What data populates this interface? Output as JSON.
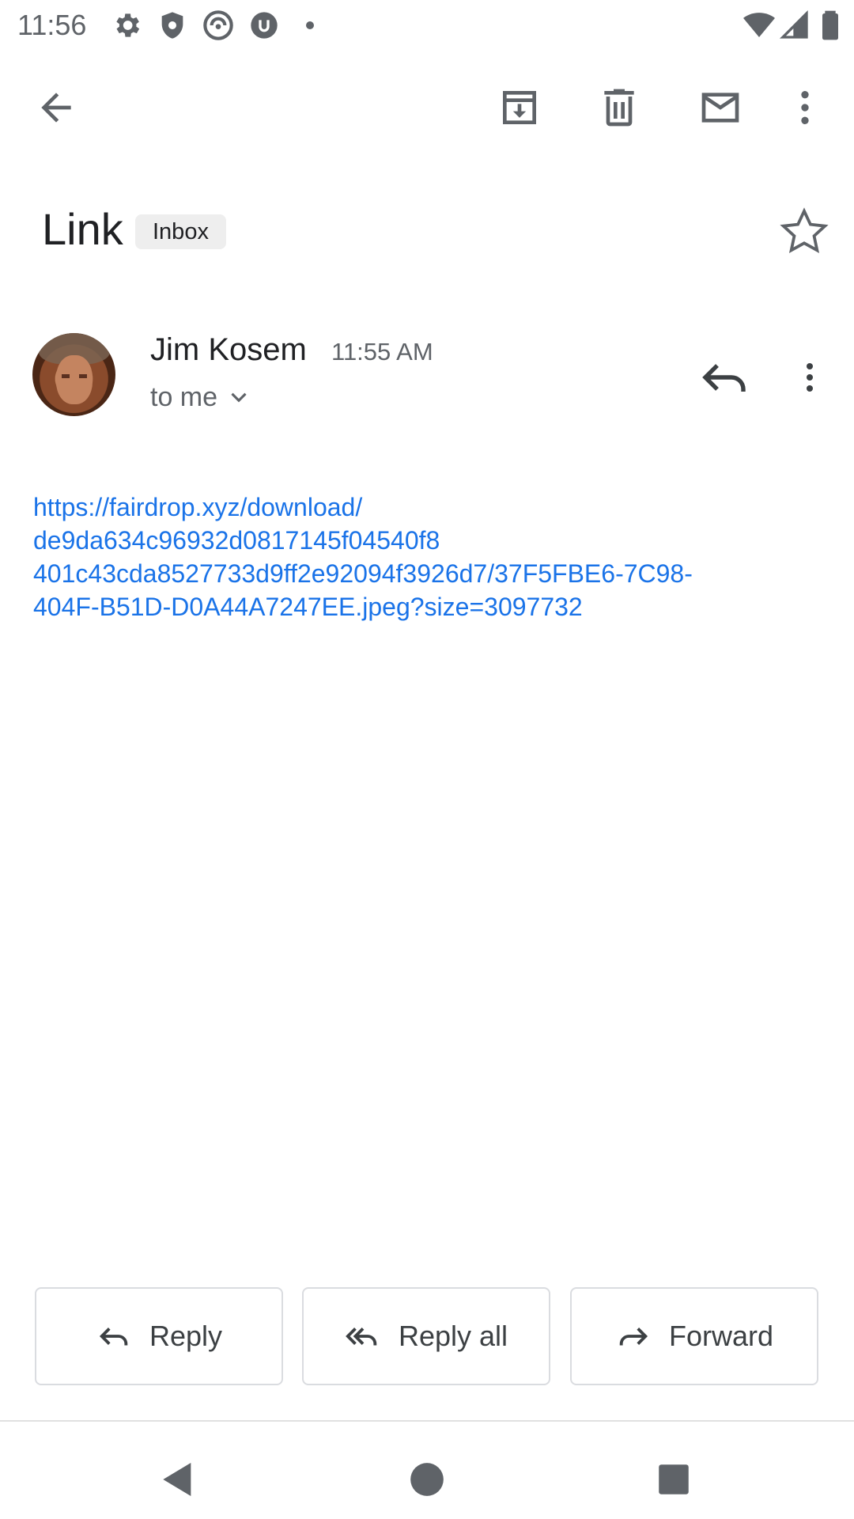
{
  "status_bar": {
    "time": "11:56",
    "icons": [
      "settings-icon",
      "shield-icon",
      "app-icon",
      "utorrent-icon",
      "notification-dot-icon",
      "wifi-icon",
      "signal-icon",
      "battery-icon"
    ]
  },
  "toolbar": {
    "back": "arrow-back-icon",
    "archive": "archive-icon",
    "delete": "delete-icon",
    "mark_unread": "mail-icon",
    "more": "more-vert-icon"
  },
  "email": {
    "subject": "Link",
    "label": "Inbox",
    "sender_name": "Jim Kosem",
    "time": "11:55 AM",
    "recipient": "to me",
    "link_lines": [
      "https://fairdrop.xyz/download/",
      "de9da634c96932d0817145f04540f8",
      "401c43cda8527733d9ff2e92094f3926d7/37F5FBE6-7C98-",
      "404F-B51D-D0A44A7247EE.jpeg?size=3097732"
    ]
  },
  "actions": {
    "reply": "Reply",
    "reply_all": "Reply all",
    "forward": "Forward"
  },
  "colors": {
    "link": "#1a73e8",
    "icon": "#5f6368",
    "badge_bg": "#eeeeee",
    "border": "#dadce0"
  }
}
